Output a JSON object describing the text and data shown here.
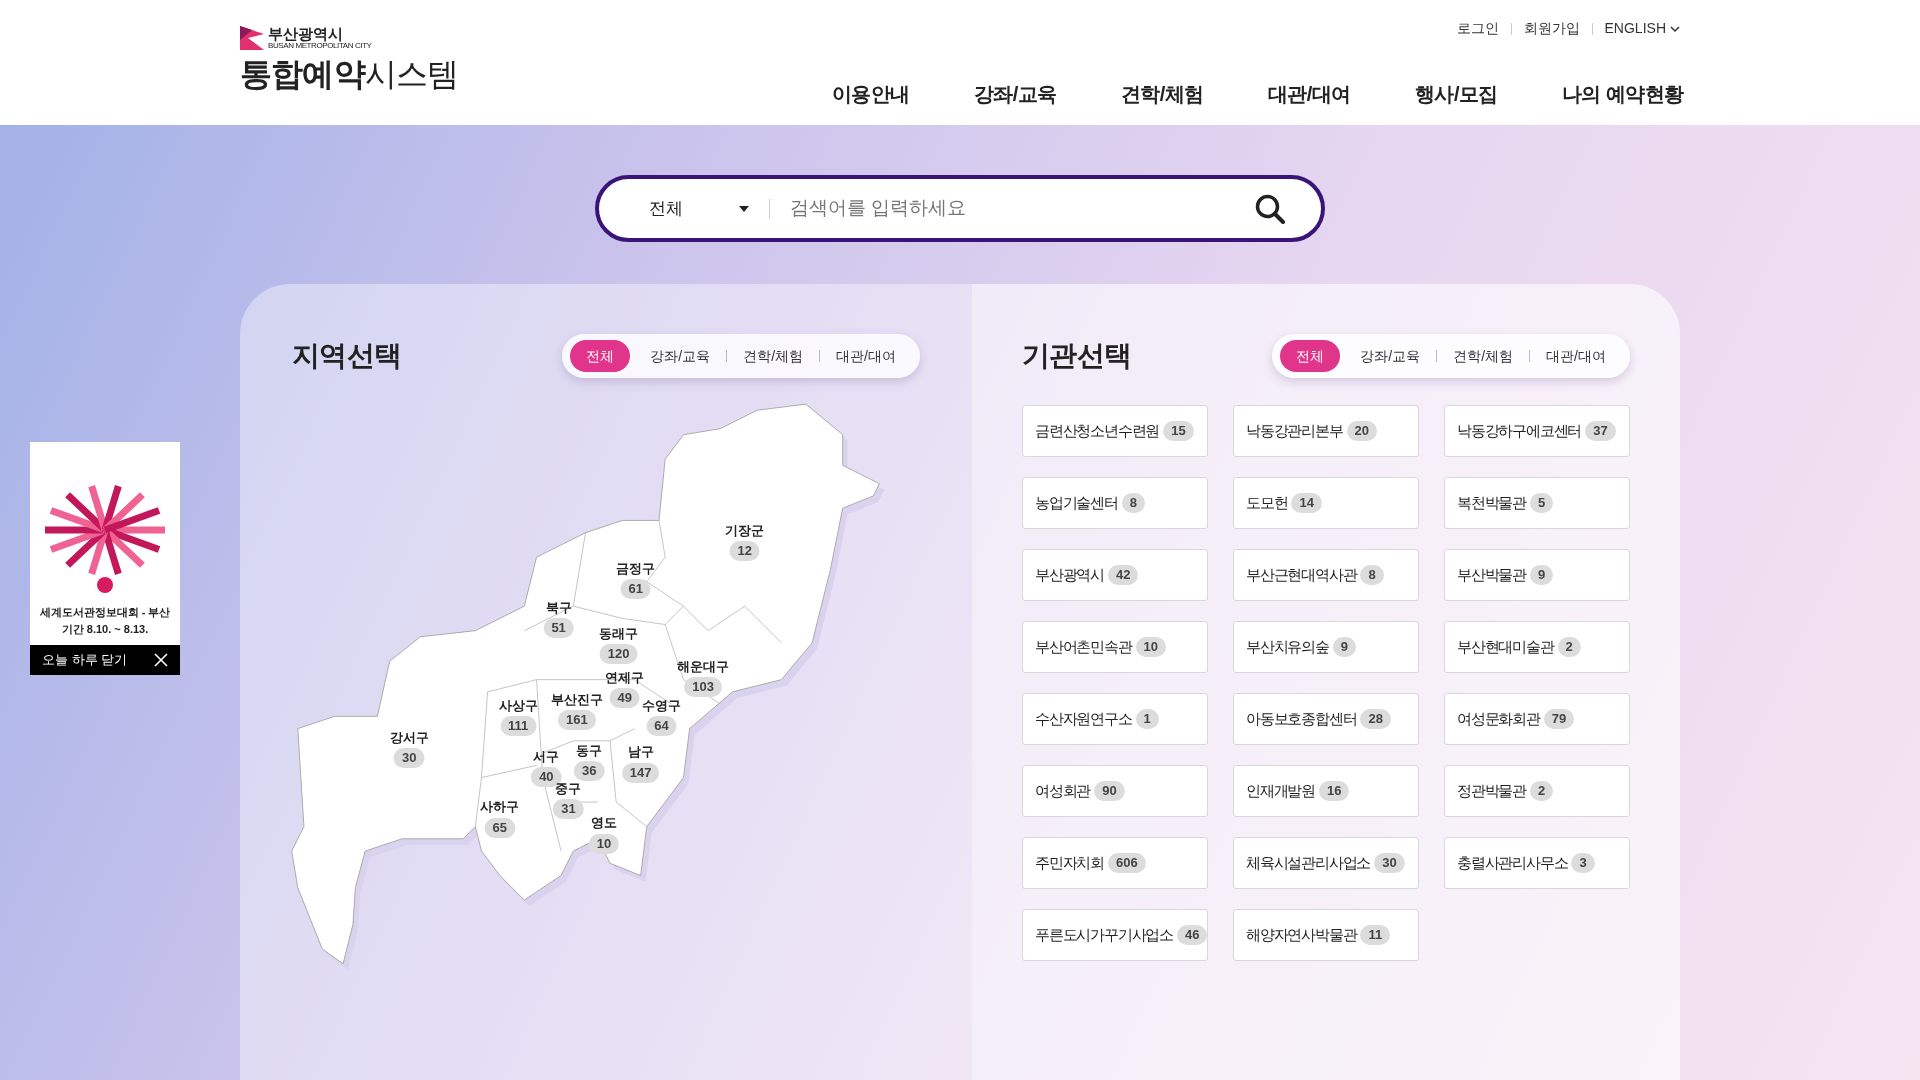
{
  "header": {
    "logo": {
      "city": "부산광역시",
      "city_en": "BUSAN METROPOLITAN CITY",
      "title_bold": "통합예약",
      "title_light": "시스템"
    },
    "util_links": [
      "로그인",
      "회원가입",
      "ENGLISH"
    ],
    "nav": [
      "이용안내",
      "강좌/교육",
      "견학/체험",
      "대관/대여",
      "행사/모집",
      "나의 예약현황"
    ]
  },
  "search": {
    "category": "전체",
    "placeholder": "검색어를 입력하세요"
  },
  "region_panel": {
    "title": "지역선택",
    "tabs": [
      {
        "label": "전체",
        "selected": true
      },
      {
        "label": "강좌/교육",
        "selected": false
      },
      {
        "label": "견학/체험",
        "selected": false
      },
      {
        "label": "대관/대여",
        "selected": false
      }
    ],
    "districts": [
      {
        "name": "기장군",
        "count": "12"
      },
      {
        "name": "금정구",
        "count": "61"
      },
      {
        "name": "북구",
        "count": "51"
      },
      {
        "name": "동래구",
        "count": "120"
      },
      {
        "name": "연제구",
        "count": "49"
      },
      {
        "name": "해운대구",
        "count": "103"
      },
      {
        "name": "사상구",
        "count": "111"
      },
      {
        "name": "부산진구",
        "count": "161"
      },
      {
        "name": "수영구",
        "count": "64"
      },
      {
        "name": "강서구",
        "count": "30"
      },
      {
        "name": "서구",
        "count": "40"
      },
      {
        "name": "동구",
        "count": "36"
      },
      {
        "name": "남구",
        "count": "147"
      },
      {
        "name": "중구",
        "count": "31"
      },
      {
        "name": "사하구",
        "count": "65"
      },
      {
        "name": "영도",
        "count": "10"
      }
    ]
  },
  "institution_panel": {
    "title": "기관선택",
    "tabs": [
      {
        "label": "전체",
        "selected": true
      },
      {
        "label": "강좌/교육",
        "selected": false
      },
      {
        "label": "견학/체험",
        "selected": false
      },
      {
        "label": "대관/대여",
        "selected": false
      }
    ],
    "institutions": [
      {
        "name": "금련산청소년수련원",
        "count": "15"
      },
      {
        "name": "낙동강관리본부",
        "count": "20"
      },
      {
        "name": "낙동강하구에코센터",
        "count": "37"
      },
      {
        "name": "농업기술센터",
        "count": "8"
      },
      {
        "name": "도모헌",
        "count": "14"
      },
      {
        "name": "복천박물관",
        "count": "5"
      },
      {
        "name": "부산광역시",
        "count": "42"
      },
      {
        "name": "부산근현대역사관",
        "count": "8"
      },
      {
        "name": "부산박물관",
        "count": "9"
      },
      {
        "name": "부산어촌민속관",
        "count": "10"
      },
      {
        "name": "부산치유의숲",
        "count": "9"
      },
      {
        "name": "부산현대미술관",
        "count": "2"
      },
      {
        "name": "수산자원연구소",
        "count": "1"
      },
      {
        "name": "아동보호종합센터",
        "count": "28"
      },
      {
        "name": "여성문화회관",
        "count": "79"
      },
      {
        "name": "여성회관",
        "count": "90"
      },
      {
        "name": "인재개발원",
        "count": "16"
      },
      {
        "name": "정관박물관",
        "count": "2"
      },
      {
        "name": "주민자치회",
        "count": "606"
      },
      {
        "name": "체육시설관리사업소",
        "count": "30"
      },
      {
        "name": "충렬사관리사무소",
        "count": "3"
      },
      {
        "name": "푸른도시가꾸기사업소",
        "count": "46"
      },
      {
        "name": "해양자연사박물관",
        "count": "11"
      }
    ]
  },
  "popup": {
    "caption": "세계도서관정보대회 - 부산",
    "period": "기간 8.10. ~ 8.13.",
    "close_label": "오늘 하루 닫기"
  }
}
